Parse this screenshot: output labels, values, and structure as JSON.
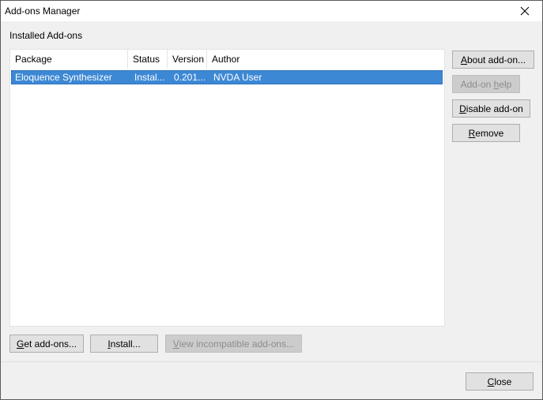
{
  "window": {
    "title": "Add-ons Manager"
  },
  "group_label": "Installed Add-ons",
  "list": {
    "columns": [
      "Package",
      "Status",
      "Version",
      "Author"
    ],
    "rows": [
      {
        "package": "Eloquence Synthesizer",
        "status": "Instal...",
        "version": "0.201...",
        "author": "NVDA User",
        "selected": true
      }
    ]
  },
  "side_buttons": {
    "about": {
      "pre": "",
      "accel": "A",
      "post": "bout add-on..."
    },
    "help": {
      "pre": "Add-on ",
      "accel": "h",
      "post": "elp",
      "disabled": true
    },
    "disable": {
      "pre": "",
      "accel": "D",
      "post": "isable add-on"
    },
    "remove": {
      "pre": "",
      "accel": "R",
      "post": "emove"
    }
  },
  "bottom_buttons": {
    "get": {
      "pre": "",
      "accel": "G",
      "post": "et add-ons..."
    },
    "install": {
      "pre": "",
      "accel": "I",
      "post": "nstall..."
    },
    "incompatible": {
      "pre": "",
      "accel": "V",
      "post": "iew incompatible add-ons...",
      "disabled": true
    }
  },
  "close_button": {
    "pre": "",
    "accel": "C",
    "post": "lose"
  },
  "colors": {
    "selection": "#3d88d5",
    "dialog_bg": "#f0f0f0",
    "button_bg": "#e1e1e1"
  },
  "icons": {
    "close": "close-icon"
  }
}
